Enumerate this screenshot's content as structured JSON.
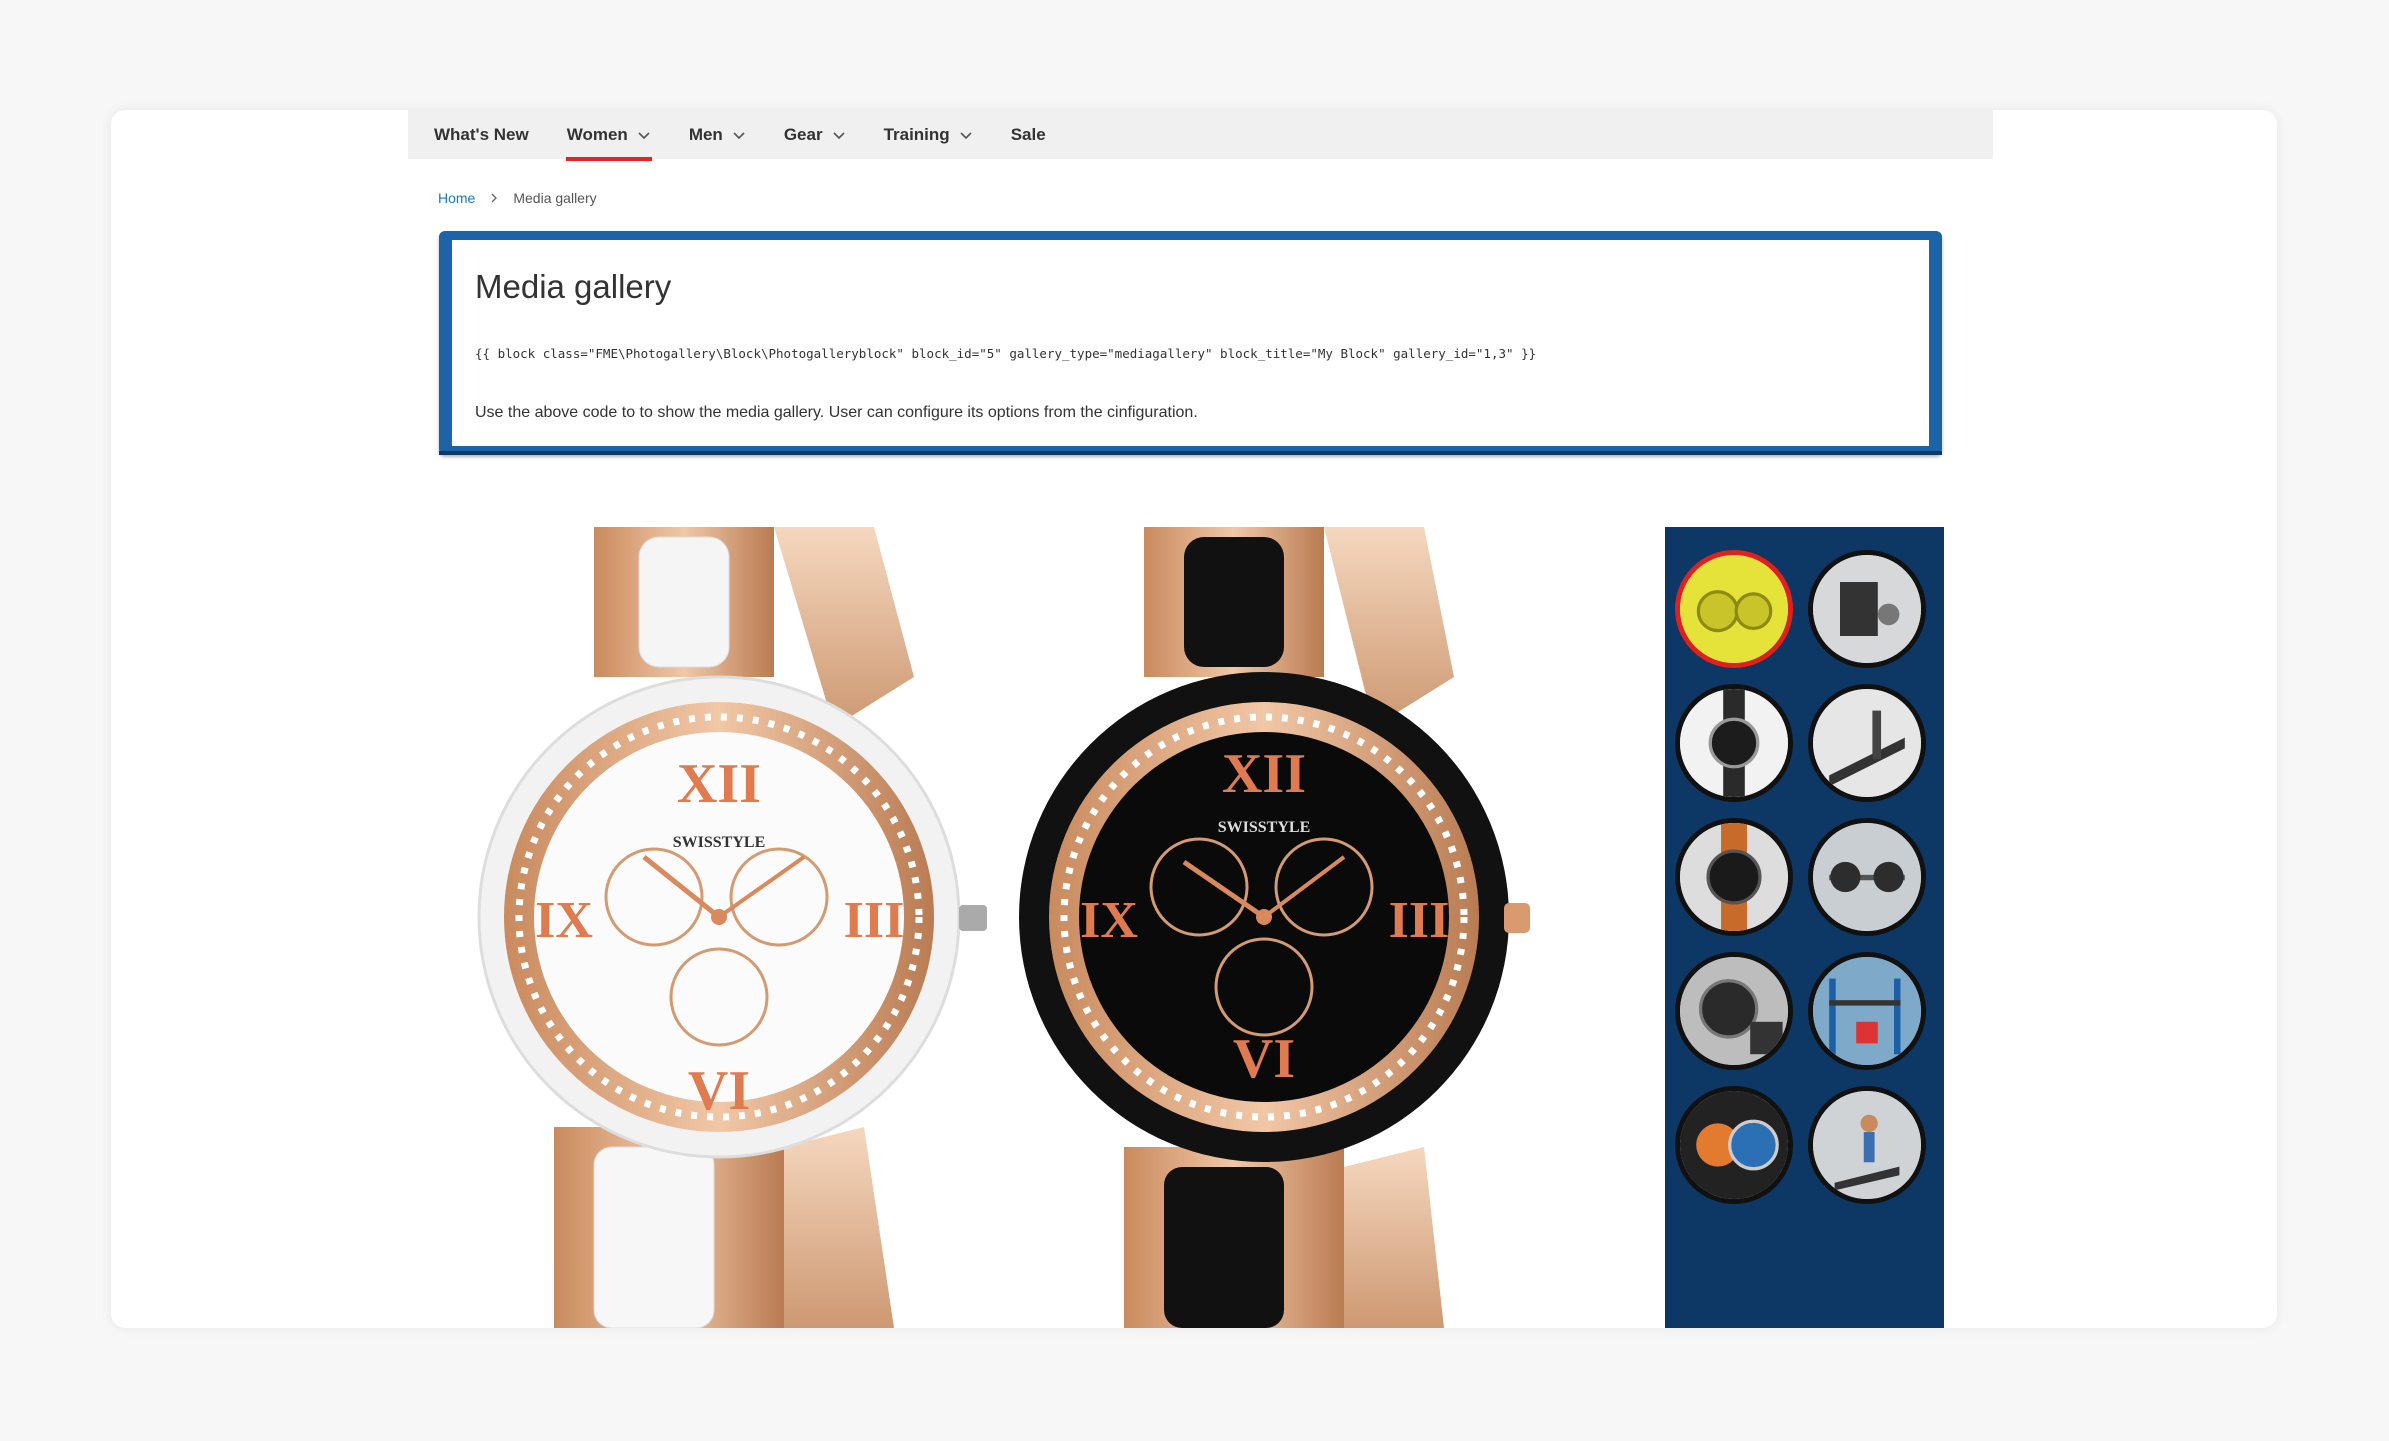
{
  "nav": {
    "items": [
      {
        "label": "What's New",
        "has_dropdown": false,
        "active": false
      },
      {
        "label": "Women",
        "has_dropdown": true,
        "active": true
      },
      {
        "label": "Men",
        "has_dropdown": true,
        "active": false
      },
      {
        "label": "Gear",
        "has_dropdown": true,
        "active": false
      },
      {
        "label": "Training",
        "has_dropdown": true,
        "active": false
      },
      {
        "label": "Sale",
        "has_dropdown": false,
        "active": false
      }
    ]
  },
  "breadcrumb": {
    "home": "Home",
    "current": "Media gallery"
  },
  "info_box": {
    "title": "Media gallery",
    "code": "{{ block class=\"FME\\Photogallery\\Block\\Photogalleryblock\" block_id=\"5\" gallery_type=\"mediagallery\" block_title=\"My Block\" gallery_id=\"1,3\" }}",
    "description": "Use the above code to to show the media gallery. User can configure its options from the cinfiguration."
  },
  "gallery": {
    "main_image": {
      "name": "watch-pair-image",
      "watch_brand": "SWISSTYLE"
    },
    "thumbnails": [
      {
        "name": "thumb-yellow-watches",
        "active": true
      },
      {
        "name": "thumb-gym-machine",
        "active": false
      },
      {
        "name": "thumb-black-watch",
        "active": false
      },
      {
        "name": "thumb-treadmill",
        "active": false
      },
      {
        "name": "thumb-orange-strap-watch",
        "active": false
      },
      {
        "name": "thumb-weights",
        "active": false
      },
      {
        "name": "thumb-chrono-watch",
        "active": false
      },
      {
        "name": "thumb-gym-rack",
        "active": false
      },
      {
        "name": "thumb-blue-watch",
        "active": false
      },
      {
        "name": "thumb-runner",
        "active": false
      }
    ]
  },
  "colors": {
    "accent_underline": "#e22626",
    "info_border": "#1d63a8",
    "thumb_panel_bg": "#0d3764",
    "link": "#1979c3"
  }
}
